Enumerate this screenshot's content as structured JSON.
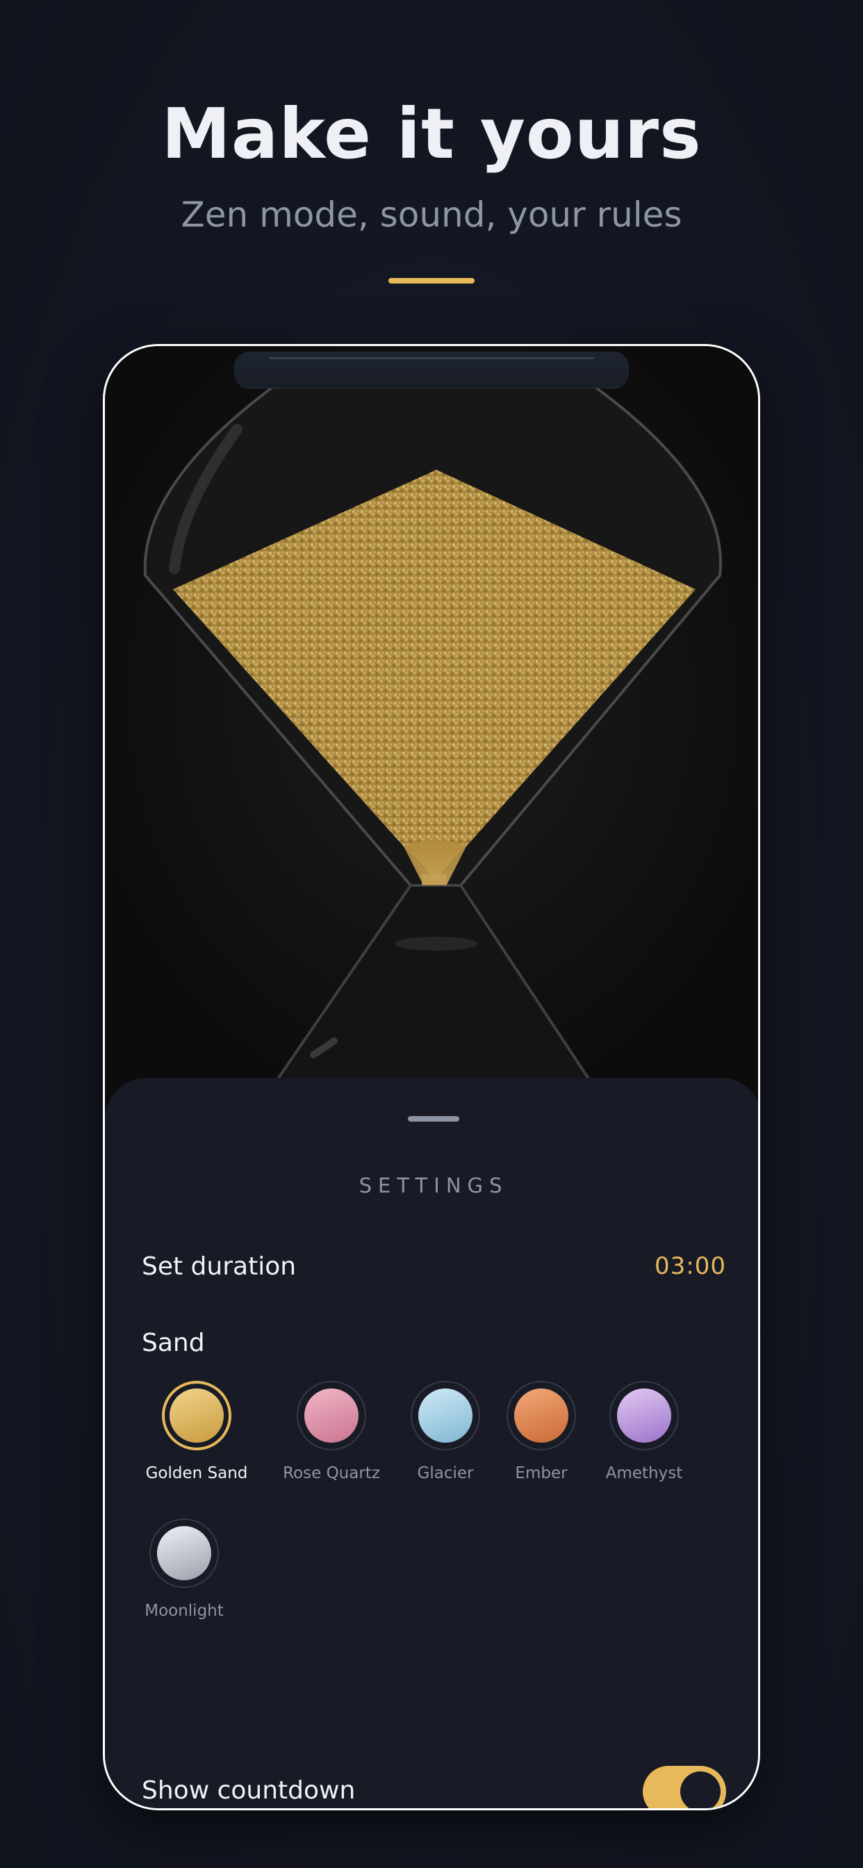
{
  "hero": {
    "title": "Make it yours",
    "subtitle": "Zen mode, sound, your rules",
    "accent_color": "#e8b95b"
  },
  "settings": {
    "title": "SETTINGS",
    "duration": {
      "label": "Set duration",
      "value": "03:00"
    },
    "sand": {
      "label": "Sand",
      "selected": "Golden Sand",
      "options": [
        {
          "name": "Golden Sand",
          "color_top": "#f0d48a",
          "color_bottom": "#c99b3f",
          "selected": true
        },
        {
          "name": "Rose Quartz",
          "color_top": "#f2b6c6",
          "color_bottom": "#c97490",
          "selected": false
        },
        {
          "name": "Glacier",
          "color_top": "#cfe9f5",
          "color_bottom": "#7fb7d3",
          "selected": false
        },
        {
          "name": "Ember",
          "color_top": "#f3a877",
          "color_bottom": "#c96a35",
          "selected": false
        },
        {
          "name": "Amethyst",
          "color_top": "#e3c9f3",
          "color_bottom": "#9a73c9",
          "selected": false
        },
        {
          "name": "Moonlight",
          "color_top": "#eef0f4",
          "color_bottom": "#9aa0ac",
          "selected": false
        }
      ]
    },
    "show_countdown": {
      "label": "Show countdown",
      "enabled": true
    }
  },
  "colors": {
    "background": "#131722",
    "sheet": "#181b25",
    "accent": "#e8b95b",
    "sand": "#b8913f"
  }
}
